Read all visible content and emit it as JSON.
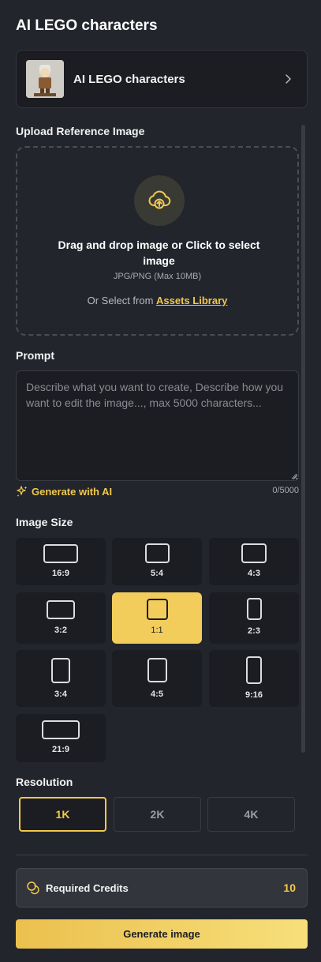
{
  "header": {
    "title": "AI LEGO characters"
  },
  "model": {
    "name": "AI LEGO characters"
  },
  "upload": {
    "label": "Upload Reference Image",
    "main_text": "Drag and drop image or Click to select image",
    "hint": "JPG/PNG (Max 10MB)",
    "alt_prefix": "Or Select from",
    "alt_link": "Assets Library"
  },
  "prompt": {
    "label": "Prompt",
    "placeholder": "Describe what you want to create, Describe how you want to edit the image..., max 5000 characters...",
    "generate_ai": "Generate with AI",
    "counter": "0/5000"
  },
  "image_size": {
    "label": "Image Size",
    "selected": "1:1",
    "options": [
      "16:9",
      "5:4",
      "4:3",
      "3:2",
      "1:1",
      "2:3",
      "3:4",
      "4:5",
      "9:16",
      "21:9"
    ]
  },
  "resolution": {
    "label": "Resolution",
    "selected": "1K",
    "options": [
      "1K",
      "2K",
      "4K"
    ]
  },
  "credits": {
    "label": "Required Credits",
    "value": "10"
  },
  "actions": {
    "generate": "Generate image"
  },
  "colors": {
    "accent": "#f2c94c",
    "background": "#23252c",
    "panel": "#1b1d22"
  }
}
